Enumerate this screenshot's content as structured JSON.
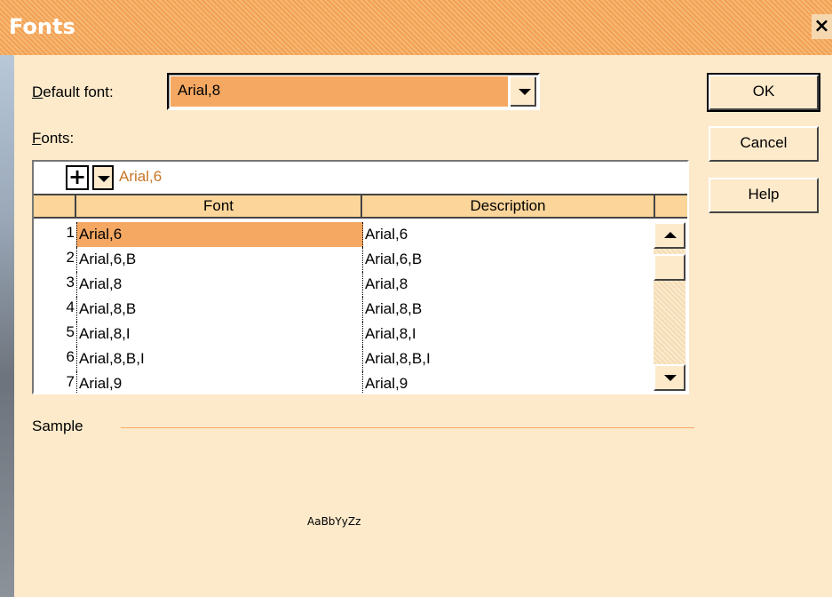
{
  "dialog": {
    "title": "Fonts",
    "close_label": "×"
  },
  "default_font": {
    "label_prefix": "D",
    "label_rest": "efault font:",
    "value": "Arial,8"
  },
  "fonts_section": {
    "label_prefix": "F",
    "label_rest": "onts:"
  },
  "toolbar": {
    "add_label": "+",
    "current_value": "Arial,6"
  },
  "table": {
    "columns": [
      "Font",
      "Description"
    ],
    "rows": [
      {
        "num": "1",
        "font": "Arial,6",
        "description": "Arial,6"
      },
      {
        "num": "2",
        "font": "Arial,6,B",
        "description": "Arial,6,B"
      },
      {
        "num": "3",
        "font": "Arial,8",
        "description": "Arial,8"
      },
      {
        "num": "4",
        "font": "Arial,8,B",
        "description": "Arial,8,B"
      },
      {
        "num": "5",
        "font": "Arial,8,I",
        "description": "Arial,8,I"
      },
      {
        "num": "6",
        "font": "Arial,8,B,I",
        "description": "Arial,8,B,I"
      },
      {
        "num": "7",
        "font": "Arial,9",
        "description": "Arial,9"
      }
    ],
    "selected_row": 0
  },
  "buttons": {
    "ok": "OK",
    "cancel": "Cancel",
    "help": "Help"
  },
  "sample": {
    "label": "Sample",
    "text": "AaBbYyZz"
  },
  "colors": {
    "accent": "#f5a862",
    "dialog_bg": "#fdeacb",
    "title_bar": "#f2a053"
  }
}
